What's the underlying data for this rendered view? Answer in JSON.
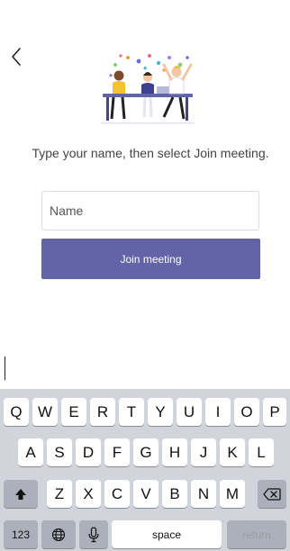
{
  "instructions": "Type your name, then select Join meeting.",
  "name_field": {
    "placeholder": "Name",
    "value": ""
  },
  "join_button": {
    "label": "Join meeting"
  },
  "colors": {
    "accent": "#6264a7",
    "keyboard_bg": "#d1d4db"
  },
  "icons": {
    "back": "chevron-left-icon",
    "illustration": "meeting-people-illustration",
    "shift": "shift-arrow-icon",
    "globe": "globe-icon",
    "microphone": "microphone-icon",
    "backspace": "backspace-icon"
  },
  "keyboard": {
    "row1": [
      "Q",
      "W",
      "E",
      "R",
      "T",
      "Y",
      "U",
      "I",
      "O",
      "P"
    ],
    "row2": [
      "A",
      "S",
      "D",
      "F",
      "G",
      "H",
      "J",
      "K",
      "L"
    ],
    "row3": [
      "Z",
      "X",
      "C",
      "V",
      "B",
      "N",
      "M"
    ],
    "numbers_label": "123",
    "space_label": "space",
    "return_label": "return"
  }
}
